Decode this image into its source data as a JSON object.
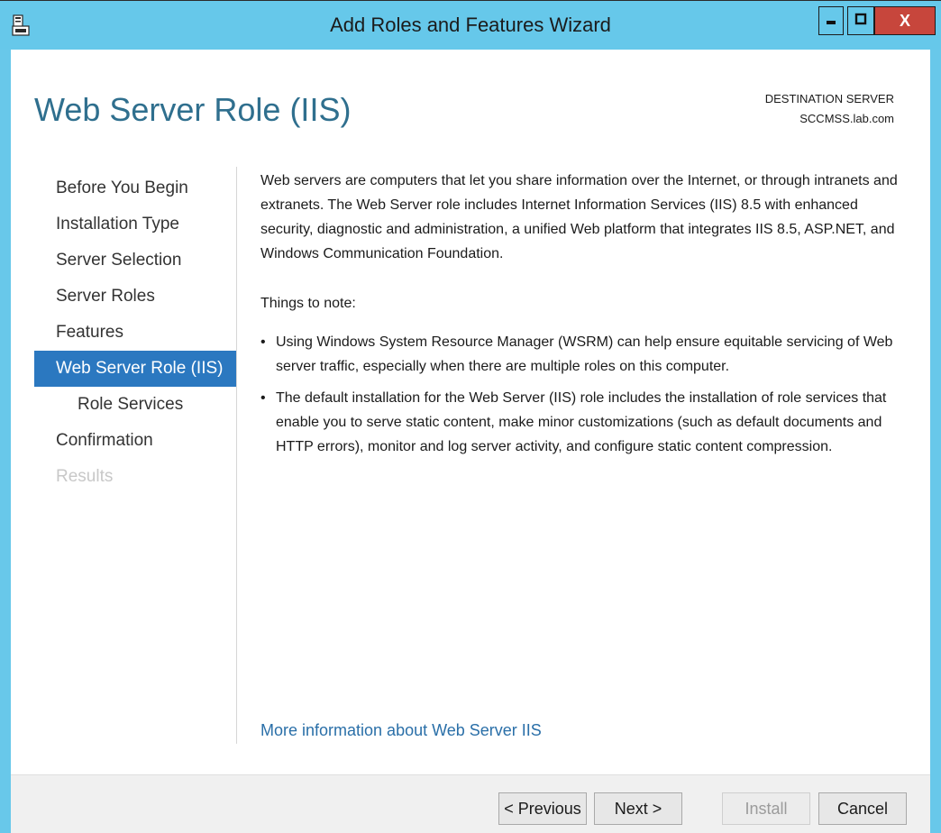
{
  "window": {
    "title": "Add Roles and Features Wizard",
    "close_label": "X"
  },
  "header": {
    "page_title": "Web Server Role (IIS)",
    "destination_label": "DESTINATION SERVER",
    "destination_server": "SCCMSS.lab.com"
  },
  "nav": {
    "items": [
      {
        "label": "Before You Begin"
      },
      {
        "label": "Installation Type"
      },
      {
        "label": "Server Selection"
      },
      {
        "label": "Server Roles"
      },
      {
        "label": "Features"
      },
      {
        "label": "Web Server Role (IIS)"
      },
      {
        "label": "Role Services"
      },
      {
        "label": "Confirmation"
      },
      {
        "label": "Results"
      }
    ]
  },
  "content": {
    "intro": "Web servers are computers that let you share information over the Internet, or through intranets and extranets. The Web Server role includes Internet Information Services (IIS) 8.5 with enhanced security, diagnostic and administration, a unified Web platform that integrates IIS 8.5, ASP.NET, and Windows Communication Foundation.",
    "things_to_note": "Things to note:",
    "bullet_glyph": "•",
    "bullets": [
      "Using Windows System Resource Manager (WSRM) can help ensure equitable servicing of Web server traffic, especially when there are multiple roles on this computer.",
      "The default installation for the Web Server (IIS) role includes the installation of role services that enable you to serve static content, make minor customizations (such as default documents and HTTP errors), monitor and log server activity, and configure static content compression."
    ],
    "more_info_link": "More information about Web Server IIS"
  },
  "footer": {
    "previous_label": "< Previous",
    "next_label": "Next >",
    "install_label": "Install",
    "cancel_label": "Cancel"
  },
  "colors": {
    "titlebar": "#66c8ea",
    "accent": "#2b78c0",
    "close": "#c7463c",
    "title_text": "#2f6f8e"
  }
}
